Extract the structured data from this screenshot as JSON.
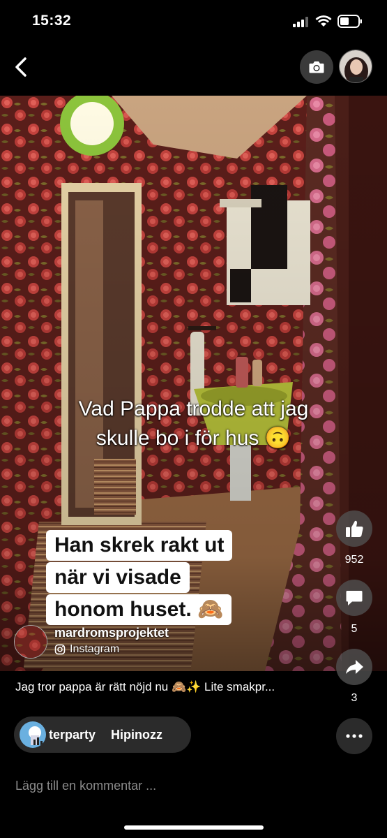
{
  "status_bar": {
    "time": "15:32"
  },
  "nav": {
    "back_icon": "chevron-left-icon",
    "camera_icon": "camera-icon"
  },
  "captions": {
    "line1": "Vad Pappa trodde att jag",
    "line2": "skulle bo i för hus 🙃",
    "overlay": [
      "Han skrek rakt ut",
      "när vi visade",
      "honom huset. 🙈"
    ]
  },
  "actions": {
    "likes": "952",
    "comments": "5",
    "shares": "3"
  },
  "author": {
    "name": "mardromsprojektet",
    "source": "Instagram"
  },
  "post": {
    "caption": "Jag tror pappa är rätt nöjd nu 🙈✨ Lite smakpr..."
  },
  "music": {
    "title_a": "terparty",
    "title_b": "Hipinozz"
  },
  "comment": {
    "placeholder": "Lägg till en kommentar ..."
  },
  "colors": {
    "accent": "#ffffff",
    "wallpaper": "#7a2a24",
    "sink": "#b8c23a"
  }
}
